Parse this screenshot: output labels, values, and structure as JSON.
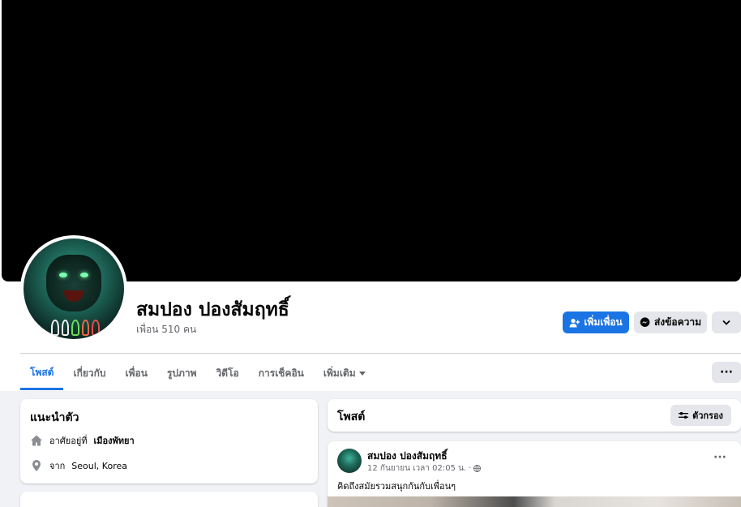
{
  "profile": {
    "name": "สมปอง ปองสัมฤทธิ์",
    "friends": "เพื่อน 510 คน"
  },
  "actions": {
    "add_friend": "เพิ่มเพื่อน",
    "message": "ส่งข้อความ",
    "more_icon": "chevron-down-icon"
  },
  "tabs": [
    {
      "label": "โพสต์",
      "active": true
    },
    {
      "label": "เกี่ยวกับ"
    },
    {
      "label": "เพื่อน"
    },
    {
      "label": "รูปภาพ"
    },
    {
      "label": "วิดีโอ"
    },
    {
      "label": "การเช็คอิน"
    },
    {
      "label": "เพิ่มเติม"
    }
  ],
  "tabs_more_dots": "···",
  "intro": {
    "title": "แนะนำตัว",
    "lives_prefix": "อาศัยอยู่ที่",
    "lives_city": "เมืองพัทยา",
    "from_prefix": "จาก",
    "from_city": "Seoul, Korea"
  },
  "posts_header": {
    "title": "โพสต์",
    "filter": "ตัวกรอง"
  },
  "post": {
    "author": "สมปอง ปองสัมฤทธิ์",
    "time": "12 กันยายน เวลา 02:05 น. ·",
    "text": "คิดถึงสมัยรวมสนุกกันกับเพื่อนๆ",
    "menu": "···"
  },
  "colors": {
    "accent": "#1b74e4",
    "button_gray": "#e4e6eb",
    "background": "#f0f2f5",
    "cover": "#000000"
  }
}
